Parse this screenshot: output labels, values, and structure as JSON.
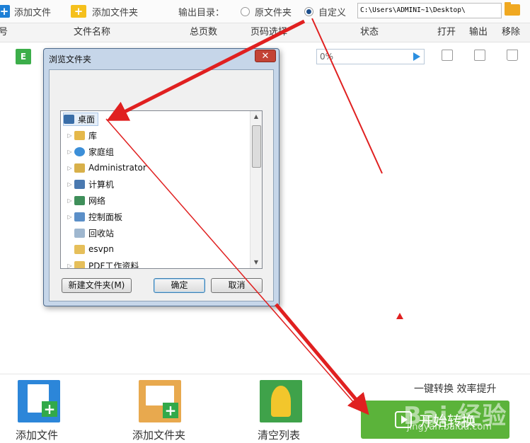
{
  "toolbar": {
    "add_file": "添加文件",
    "add_folder": "添加文件夹",
    "output_dir_label": "输出目录：",
    "radio_source": "原文件夹",
    "radio_custom": "自定义",
    "path_value": "C:\\Users\\ADMINI~1\\Desktop\\"
  },
  "table": {
    "columns": [
      "号",
      "文件名称",
      "总页数",
      "页码选择",
      "状态",
      "打开",
      "输出",
      "移除"
    ],
    "row": {
      "badge": "E",
      "progress_text": "0%",
      "progress_value": 0
    }
  },
  "dialog": {
    "title": "浏览文件夹",
    "close_label": "✕",
    "tree": [
      {
        "label": "桌面",
        "icon": "desktop-icon",
        "selected": true,
        "expandable": false
      },
      {
        "label": "库",
        "icon": "library-icon",
        "expandable": true
      },
      {
        "label": "家庭组",
        "icon": "homegroup-icon",
        "expandable": true
      },
      {
        "label": "Administrator",
        "icon": "user-folder-icon",
        "expandable": true
      },
      {
        "label": "计算机",
        "icon": "computer-icon",
        "expandable": true
      },
      {
        "label": "网络",
        "icon": "network-icon",
        "expandable": true
      },
      {
        "label": "控制面板",
        "icon": "control-panel-icon",
        "expandable": true
      },
      {
        "label": "回收站",
        "icon": "recycle-bin-icon",
        "expandable": false
      },
      {
        "label": "esvpn",
        "icon": "folder-icon",
        "expandable": false
      },
      {
        "label": "PDF工作资料",
        "icon": "folder-icon",
        "expandable": true
      }
    ],
    "new_folder_label": "新建文件夹(M)",
    "ok_label": "确定",
    "cancel_label": "取消"
  },
  "bottom": {
    "add_file": "添加文件",
    "add_folder": "添加文件夹",
    "clear_list": "清空列表",
    "slogan": "一键转换  效率提升",
    "start_label": "开始转换"
  },
  "watermark": {
    "text": "Bai 经验",
    "sub": "jingyan.baidu.com"
  },
  "colors": {
    "accent_blue": "#1c7fd6",
    "start_green": "#5bb33a",
    "annotation_red": "#e02020"
  }
}
